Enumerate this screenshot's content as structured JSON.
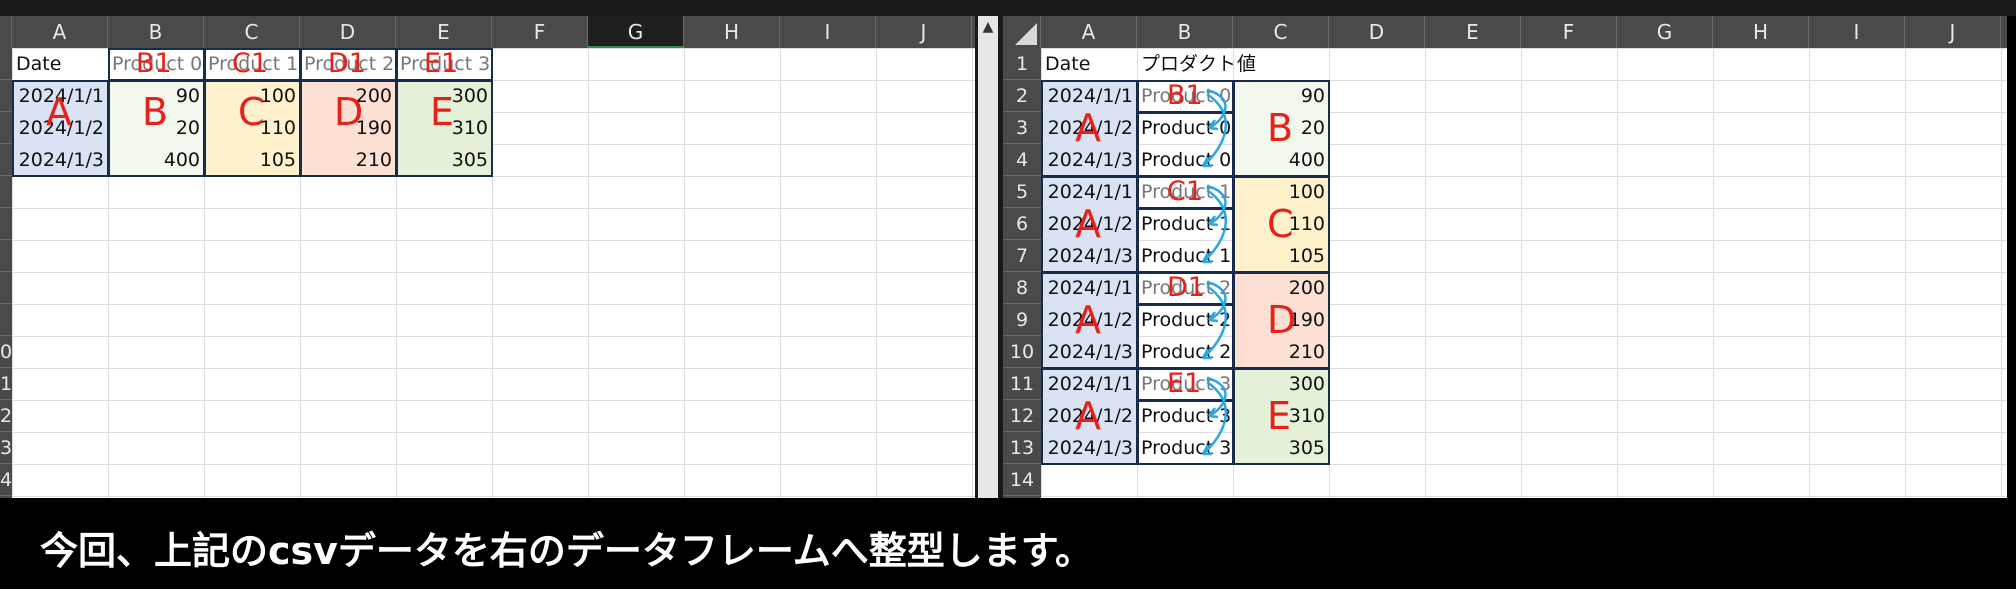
{
  "left_sheet": {
    "columns": [
      "A",
      "B",
      "C",
      "D",
      "E",
      "F",
      "G",
      "H",
      "I",
      "J"
    ],
    "selected_column": "G",
    "rows": [
      "",
      "",
      "",
      "",
      "",
      "",
      "",
      "",
      "",
      "0",
      "1",
      "2",
      "3",
      "4"
    ],
    "header": [
      "Date",
      "Product 0",
      "Product 1",
      "Product 2",
      "Product 3"
    ],
    "data": [
      [
        "2024/1/1",
        "90",
        "100",
        "200",
        "300"
      ],
      [
        "2024/1/2",
        "20",
        "110",
        "190",
        "310"
      ],
      [
        "2024/1/3",
        "400",
        "105",
        "210",
        "305"
      ]
    ],
    "group_labels": [
      "A",
      "B",
      "C",
      "D",
      "E"
    ],
    "header_labels": [
      "B1",
      "C1",
      "D1",
      "E1"
    ]
  },
  "right_sheet": {
    "columns": [
      "A",
      "B",
      "C",
      "D",
      "E",
      "F",
      "G",
      "H",
      "I",
      "J"
    ],
    "rows": [
      "1",
      "2",
      "3",
      "4",
      "5",
      "6",
      "7",
      "8",
      "9",
      "10",
      "11",
      "12",
      "13",
      "14"
    ],
    "header": [
      "Date",
      "プロダクト",
      "値"
    ],
    "data": [
      [
        "2024/1/1",
        "Product 0",
        "90"
      ],
      [
        "2024/1/2",
        "Product 0",
        "20"
      ],
      [
        "2024/1/3",
        "Product 0",
        "400"
      ],
      [
        "2024/1/1",
        "Product 1",
        "100"
      ],
      [
        "2024/1/2",
        "Product 1",
        "110"
      ],
      [
        "2024/1/3",
        "Product 1",
        "105"
      ],
      [
        "2024/1/1",
        "Product 2",
        "200"
      ],
      [
        "2024/1/2",
        "Product 2",
        "190"
      ],
      [
        "2024/1/3",
        "Product 2",
        "210"
      ],
      [
        "2024/1/1",
        "Product 3",
        "300"
      ],
      [
        "2024/1/2",
        "Product 3",
        "310"
      ],
      [
        "2024/1/3",
        "Product 3",
        "305"
      ]
    ],
    "group_labels_a": [
      "A",
      "A",
      "A",
      "A"
    ],
    "group_labels_value": [
      "B",
      "C",
      "D",
      "E"
    ],
    "header_labels": [
      "B1",
      "C1",
      "D1",
      "E1"
    ]
  },
  "colors": {
    "date_fill": "#dae3f3",
    "b_fill": "#f3f8ee",
    "c_fill": "#fff1cc",
    "d_fill": "#fbe0d3",
    "e_fill": "#e4f0d7",
    "annotation_red": "#e8201a",
    "arrow_blue": "#29a8e0"
  },
  "scroll_icon": "triangle-up-icon",
  "caption": "今回、上記のcsvデータを右のデータフレームへ整型します。"
}
